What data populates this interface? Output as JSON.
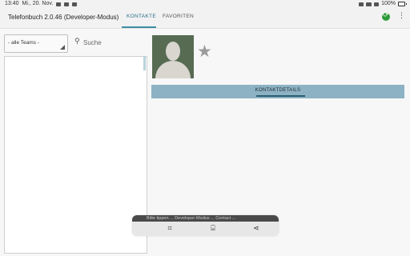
{
  "status_bar": {
    "time": "13:40",
    "date": "Mi., 20. Nov.",
    "battery": "100%"
  },
  "app": {
    "title": "Telefonbuch 2.0.46 (Developer-Modus)",
    "tabs": [
      {
        "label": "KONTAKTE",
        "active": true
      },
      {
        "label": "FAVORITEN",
        "active": false
      }
    ]
  },
  "filter": {
    "team_select_value": "- alle Teams -",
    "search_placeholder": "Suche"
  },
  "detail": {
    "section_label": "KONTAKTDETAILS"
  },
  "toolbar": {
    "ghost_text": "Bitte tippen ... Developer-Modus ... Contact ..."
  },
  "icons": {
    "sync": "sync-icon",
    "more": "more-vertical-icon",
    "search": "search-icon",
    "favorite": "star-icon"
  },
  "colors": {
    "accent": "#3f8ea5",
    "detail_bar": "#8cb2c3",
    "sync_green": "#2e9a3a",
    "avatar_bg": "#576b52"
  }
}
